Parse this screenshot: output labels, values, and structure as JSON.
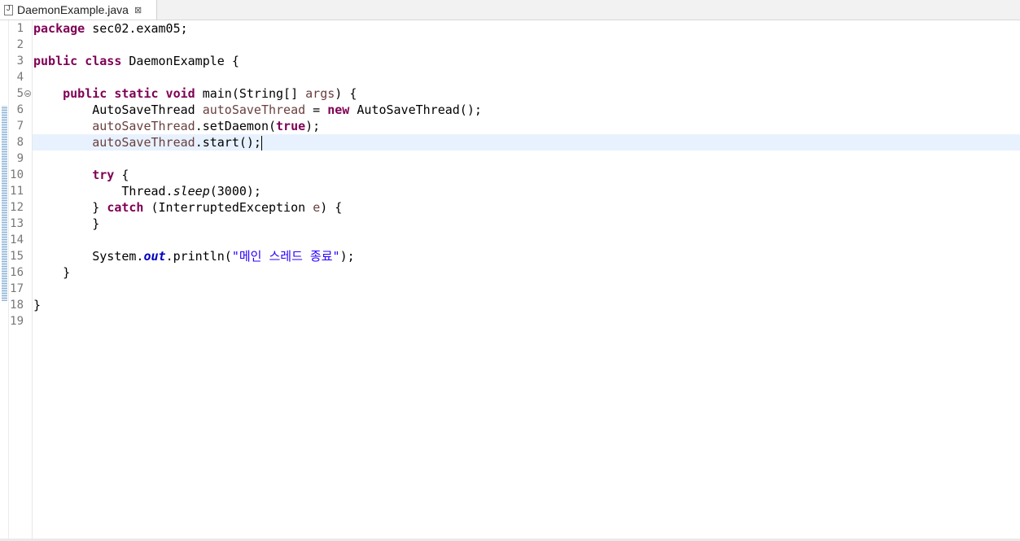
{
  "tab": {
    "title": "DaemonExample.java",
    "close_glyph": "⊠"
  },
  "line_numbers": [
    "1",
    "2",
    "3",
    "4",
    "5",
    "6",
    "7",
    "8",
    "9",
    "10",
    "11",
    "12",
    "13",
    "14",
    "15",
    "16",
    "17",
    "18",
    "19"
  ],
  "code": {
    "l1": {
      "kw": "package",
      "rest": " sec02.exam05;"
    },
    "l3": {
      "kw": "public class",
      "rest": " DaemonExample {"
    },
    "l5": {
      "indent": "    ",
      "kw": "public static void",
      "rest": " main(String[] ",
      "param": "args",
      "end": ") {"
    },
    "l6": {
      "indent": "        ",
      "type": "AutoSaveThread ",
      "var": "autoSaveThread",
      "mid": " = ",
      "kw": "new",
      "rest": " AutoSaveThread();"
    },
    "l7": {
      "indent": "        ",
      "var": "autoSaveThread",
      "mid": ".setDaemon(",
      "kw": "true",
      "rest": ");"
    },
    "l8": {
      "indent": "        ",
      "var": "autoSaveThread",
      "rest": ".start();"
    },
    "l10": {
      "indent": "        ",
      "kw": "try",
      "rest": " {"
    },
    "l11": {
      "indent": "            ",
      "pre": "Thread.",
      "method": "sleep",
      "rest": "(3000);"
    },
    "l12": {
      "indent": "        ",
      "pre": "} ",
      "kw": "catch",
      "mid": " (InterruptedException ",
      "var": "e",
      "rest": ") {"
    },
    "l13": {
      "text": "        }"
    },
    "l15": {
      "indent": "        ",
      "pre": "System.",
      "field": "out",
      "mid": ".println(",
      "str": "\"메인 스레드 종료\"",
      "rest": ");"
    },
    "l16": {
      "text": "    }"
    },
    "l18": {
      "text": "}"
    }
  },
  "current_line": 8,
  "colors": {
    "keyword": "#7f0055",
    "local_var": "#6a3e3e",
    "string": "#2a00ff",
    "static_field": "#0000c0",
    "current_line_bg": "#e8f2fe"
  }
}
